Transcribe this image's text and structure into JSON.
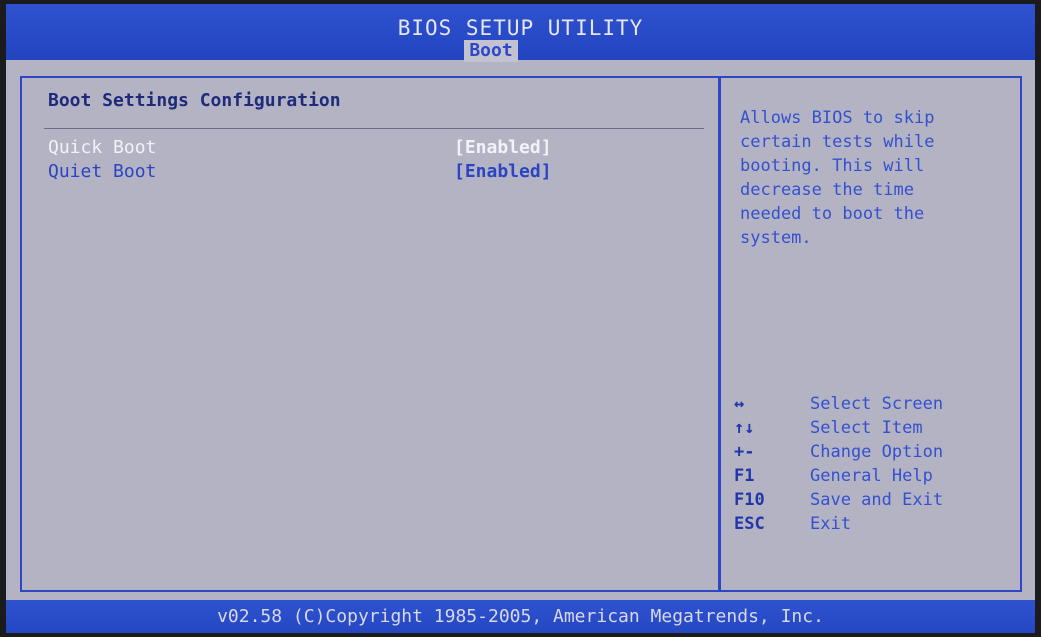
{
  "header": {
    "title": "BIOS SETUP UTILITY",
    "active_tab": "Boot"
  },
  "main": {
    "section_title": "Boot Settings Configuration",
    "settings": [
      {
        "label": "Quick Boot",
        "value": "[Enabled]",
        "selected": true
      },
      {
        "label": "Quiet Boot",
        "value": "[Enabled]",
        "selected": false
      }
    ]
  },
  "help": {
    "text": "Allows BIOS to skip\ncertain tests while\nbooting. This will\ndecrease the time\nneeded to boot the\nsystem."
  },
  "keys": [
    {
      "key": "↔",
      "desc": "Select Screen"
    },
    {
      "key": "↑↓",
      "desc": "Select Item"
    },
    {
      "key": "+-",
      "desc": "Change Option"
    },
    {
      "key": "F1",
      "desc": "General Help"
    },
    {
      "key": "F10",
      "desc": "Save and Exit"
    },
    {
      "key": "ESC",
      "desc": "Exit"
    }
  ],
  "footer": {
    "copyright": "v02.58 (C)Copyright 1985-2005, American Megatrends, Inc."
  }
}
